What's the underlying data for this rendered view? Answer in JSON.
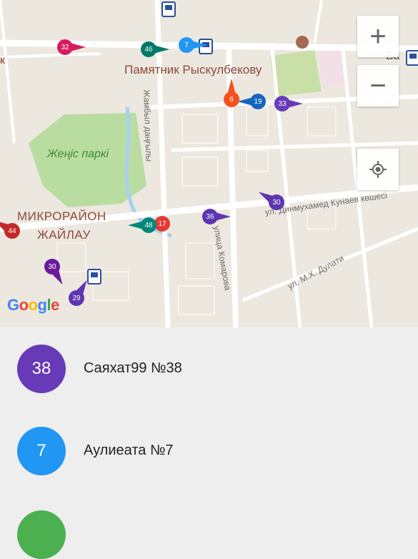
{
  "map": {
    "poi_label": "Памятник Рыскулбекову",
    "district_line1": "МИКРОРАЙОН",
    "district_line2": "ЖАЙЛАУ",
    "park_label": "Жеңіс паркі",
    "street_zhambyl": "Жамбыл даңғылы",
    "street_komarova": "улица Комарова",
    "street_kunaev": "ул. Динмухамед Кунаев көшесі",
    "street_dulati": "ул. М.Х. Дулати",
    "left_edge_label": "к",
    "right_edge_label": "Ба",
    "google_logo": [
      "G",
      "o",
      "o",
      "g",
      "l",
      "e"
    ],
    "zoom_in_label": "+",
    "zoom_out_label": "−",
    "my_location_icon": "crosshair-icon",
    "markers": [
      {
        "label": "32",
        "color": "#d81b60"
      },
      {
        "label": "46",
        "color": "#00796b"
      },
      {
        "label": "7",
        "color": "#2196f3"
      },
      {
        "label": "33",
        "color": "#673ab7"
      },
      {
        "label": "19",
        "color": "#1565c0"
      },
      {
        "label": "6",
        "color": "#f4511e"
      },
      {
        "label": "30",
        "color": "#5e35b1"
      },
      {
        "label": "36",
        "color": "#5e35b1"
      },
      {
        "label": "17",
        "color": "#e53935"
      },
      {
        "label": "48",
        "color": "#00897b"
      },
      {
        "label": "44",
        "color": "#c62828"
      },
      {
        "label": "30",
        "color": "#6a1b9a"
      },
      {
        "label": "29",
        "color": "#5e35b1"
      }
    ]
  },
  "routes": [
    {
      "number": "38",
      "name": "Саяхат99 №38",
      "color": "#673ab7"
    },
    {
      "number": "7",
      "name": "Аулиеата №7",
      "color": "#2196f3"
    },
    {
      "number": "",
      "name": "",
      "color": "#4caf50"
    }
  ]
}
